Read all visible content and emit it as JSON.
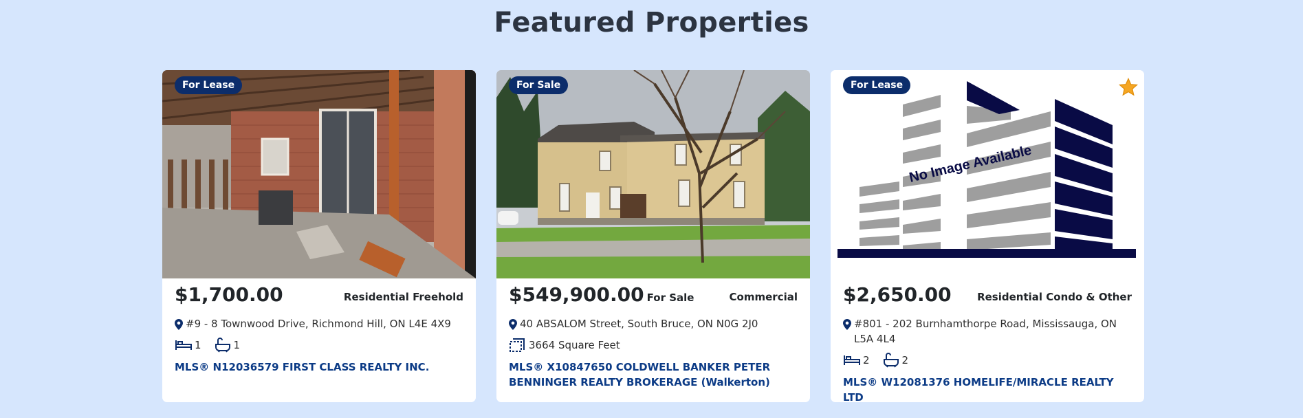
{
  "section": {
    "title": "Featured Properties"
  },
  "colors": {
    "page_bg": "#d6e6fd",
    "badge_bg": "#0c2d6b",
    "mls_link": "#0c3b86",
    "star": "#f5a623"
  },
  "listings": [
    {
      "badge": "For Lease",
      "price": "$1,700.00",
      "price_note": "",
      "type": "Residential Freehold",
      "address": "#9 - 8 Townwood Drive, Richmond Hill, ON L4E 4X9",
      "beds": "1",
      "baths": "1",
      "mls": "MLS® N12036579 FIRST CLASS REALTY INC."
    },
    {
      "badge": "For Sale",
      "price": "$549,900.00",
      "price_note": "For Sale",
      "type": "Commercial",
      "address": "40 ABSALOM Street, South Bruce, ON N0G 2J0",
      "area": "3664 Square Feet",
      "mls": "MLS® X10847650 COLDWELL BANKER PETER BENNINGER REALTY BROKERAGE (Walkerton)"
    },
    {
      "badge": "For Lease",
      "price": "$2,650.00",
      "price_note": "",
      "type": "Residential Condo & Other",
      "address": "#801 - 202 Burnhamthorpe Road, Mississauga, ON L5A 4L4",
      "beds": "2",
      "baths": "2",
      "mls": "MLS® W12081376 HOMELIFE/MIRACLE REALTY LTD",
      "image_text": "No Image Available",
      "favorite_icon": "star-icon"
    }
  ]
}
